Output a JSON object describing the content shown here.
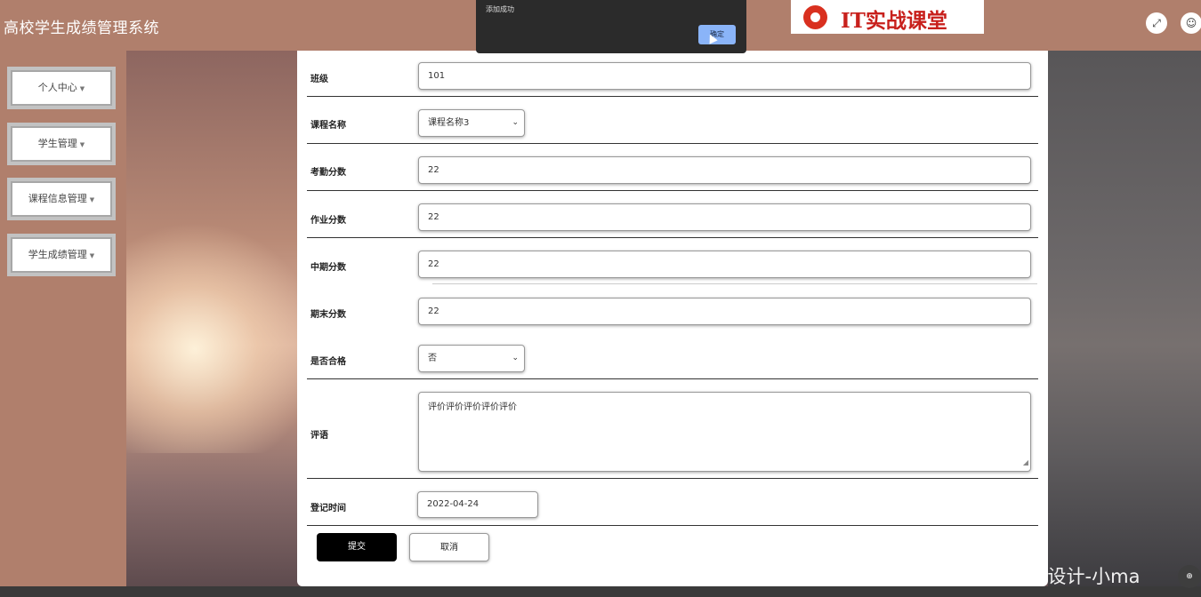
{
  "header": {
    "app_title": "高校学生成绩管理系统",
    "logo_text": "IT实战课堂",
    "icons": [
      "fullscreen-icon",
      "user-icon"
    ]
  },
  "sidebar": {
    "items": [
      {
        "label": "个人中心"
      },
      {
        "label": "学生管理"
      },
      {
        "label": "课程信息管理"
      },
      {
        "label": "学生成绩管理"
      }
    ]
  },
  "dialog": {
    "message": "添加成功",
    "ok_label": "确定"
  },
  "form": {
    "class_label": "班级",
    "class_value": "101",
    "course_label": "课程名称",
    "course_value": "课程名称3",
    "attendance_label": "考勤分数",
    "attendance_value": "22",
    "homework_label": "作业分数",
    "homework_value": "22",
    "midterm_label": "中期分数",
    "midterm_value": "22",
    "final_label": "期末分数",
    "final_value": "22",
    "pass_label": "是否合格",
    "pass_value": "否",
    "comment_label": "评语",
    "comment_value": "评价评价评价评价评价",
    "date_label": "登记时间",
    "date_value": "2022-04-24",
    "submit_label": "提交",
    "cancel_label": "取消"
  },
  "watermark": "CSDN @计算机毕业设计-小ma",
  "colors": {
    "header_bg": "#b07f6c",
    "submit_bg": "#000000",
    "dialog_bg": "#2b2b2b",
    "dialog_button": "#8ab4f8",
    "logo_red": "#c8201c"
  }
}
